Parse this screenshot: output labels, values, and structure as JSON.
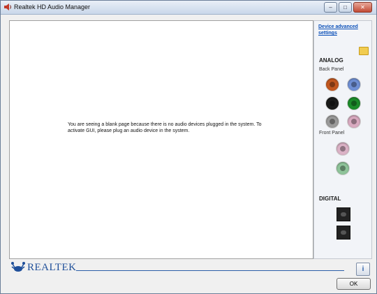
{
  "window": {
    "title": "Realtek HD Audio Manager",
    "controls": [
      "–",
      "□",
      "✕"
    ]
  },
  "main": {
    "message": "You are seeing a blank page because there is no audio devices plugged in the system. To activate GUI, please plug an audio device in the system."
  },
  "sidebar": {
    "device_advanced_settings": "Device advanced settings",
    "analog_title": "ANALOG",
    "back_panel_label": "Back Panel",
    "front_panel_label": "Front Panel",
    "digital_title": "DIGITAL",
    "back_jack_colors": [
      "#c2571f",
      "#6f8fd4",
      "#1a1a1a",
      "#1c8c2a",
      "#9a9a9a",
      "#d9aac0"
    ],
    "front_jack_colors": [
      "#dbb2c6",
      "#8fc49a"
    ]
  },
  "footer": {
    "brand": "REALTEK",
    "info_icon_label": "i",
    "ok_label": "OK"
  }
}
